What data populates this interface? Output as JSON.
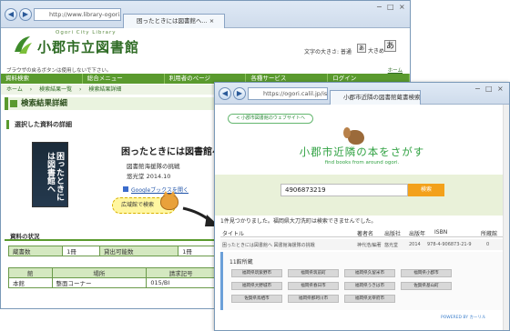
{
  "back_window": {
    "address": "http://www.library-ogori.jp/",
    "tab_title": "困ったときには図書館へ... ×",
    "header": {
      "logo_en": "Ogori City Library",
      "logo_jp": "小郡市立図書館",
      "fontsize_label": "文字の大きさ: 普通",
      "fontsize_a": "あ",
      "fontsize_large": "大きめ",
      "fontsize_big_a": "あ"
    },
    "notice": "ブラウザの戻るボタンは使用しないで下さい。",
    "home_link": "ホーム",
    "nav": [
      "資料検索",
      "総合メニュー",
      "利用者のページ",
      "各種サービス",
      "ログイン"
    ],
    "breadcrumb": [
      "ホーム",
      "検索結果一覧",
      "検索結果詳細"
    ],
    "page_heading": "検索結果詳細",
    "section_detail": "選択した資料の詳細",
    "book": {
      "cover_title": "困ったときには図書館へ",
      "title": "困ったときには図書館へ",
      "author": "図書館海援隊の挑戦",
      "publisher": "悠光堂 2014.10",
      "google_link": "Googleブックスを開く",
      "local_search": "広域館で検索"
    },
    "holdings_heading": "資料の状況",
    "status_table": {
      "label1": "蔵書数",
      "value1": "1冊",
      "label2": "貸出可能数",
      "value2": "1冊"
    },
    "location_table": {
      "headers": [
        "館",
        "場所",
        "請求記号"
      ],
      "row": [
        "本館",
        "整面コーナー",
        "015/BI"
      ]
    }
  },
  "front_window": {
    "address": "https://ogori.calil.jp/isbn",
    "tab_title": "小郡市近隣の図書館蔵書検索 ×",
    "back_link": "< 小郡市図書館のウェブサイトへ",
    "title": "小郡市近隣の本をさがす",
    "subtitle": "find books from around ogori.",
    "search_value": "4906873219",
    "search_button": "検索",
    "result_message": "1件見つかりました。福岡県大刀洗町は検索できませんでした。",
    "columns": [
      "タイトル",
      "著者名",
      "出版社",
      "出版年",
      "ISBN",
      "所蔵館"
    ],
    "row": [
      "困ったときには図書館へ 図書館海援隊の挑戦",
      "神代浩/編著",
      "悠光堂",
      "2014",
      "978-4-906873-21-9",
      "0"
    ],
    "system_name": "11館所蔵",
    "libraries": [
      "福岡県筑紫野市",
      "福岡県筑前町",
      "福岡県久留米市",
      "福岡県小郡市",
      "福岡県大野城市",
      "福岡県春日市",
      "福岡県うきは市",
      "佐賀県基山町",
      "佐賀県鳥栖市",
      "福岡県那珂川市",
      "福岡県太宰府市"
    ],
    "powered": "POWERED BY カーリル"
  }
}
